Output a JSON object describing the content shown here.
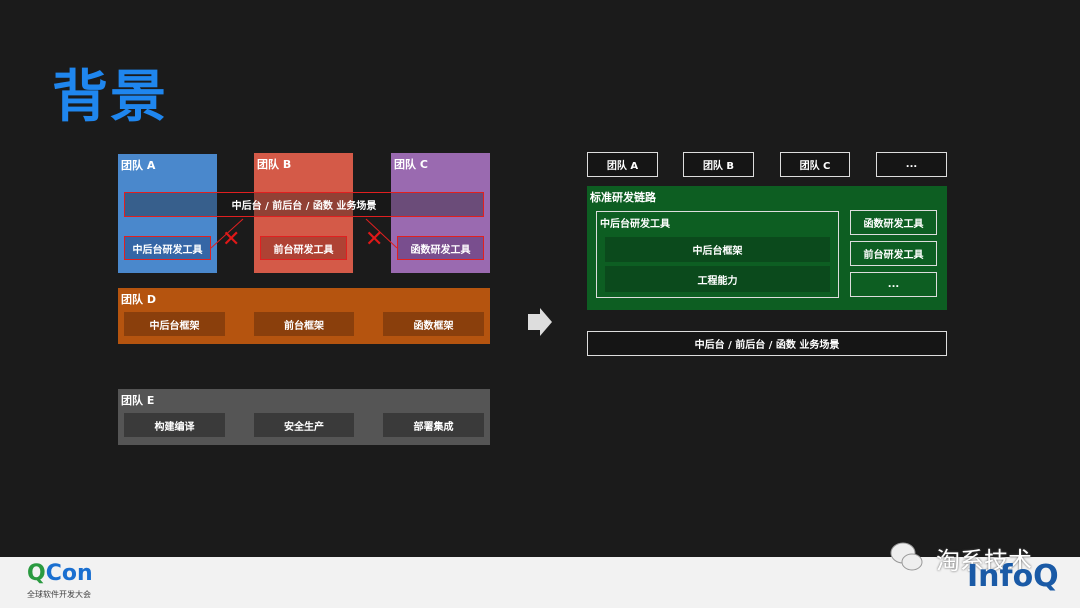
{
  "title": "背景",
  "left": {
    "teams": [
      {
        "label": "团队 A",
        "tool": "中后台研发工具",
        "color": "#4a88cc"
      },
      {
        "label": "团队 B",
        "tool": "前台研发工具",
        "color": "#d45a48"
      },
      {
        "label": "团队 C",
        "tool": "函数研发工具",
        "color": "#9a6ab0"
      }
    ],
    "scenario": "中后台 / 前后台 / 函数 业务场景",
    "team_d": {
      "label": "团队 D",
      "items": [
        "中后台框架",
        "前台框架",
        "函数框架"
      ]
    },
    "team_e": {
      "label": "团队 E",
      "items": [
        "构建编译",
        "安全生产",
        "部署集成"
      ]
    }
  },
  "right": {
    "teams": [
      "团队 A",
      "团队 B",
      "团队 C",
      "..."
    ],
    "chain": {
      "label": "标准研发链路",
      "inner_label": "中后台研发工具",
      "inner_items": [
        "中后台框架",
        "工程能力"
      ],
      "side": [
        "函数研发工具",
        "前台研发工具",
        "..."
      ]
    },
    "scenario": "中后台 / 前后台 / 函数 业务场景"
  },
  "footer": {
    "qcon": "QCon",
    "qcon_sub": "全球软件开发大会",
    "watermark": "淘系技术",
    "infoq": "InfoQ"
  }
}
